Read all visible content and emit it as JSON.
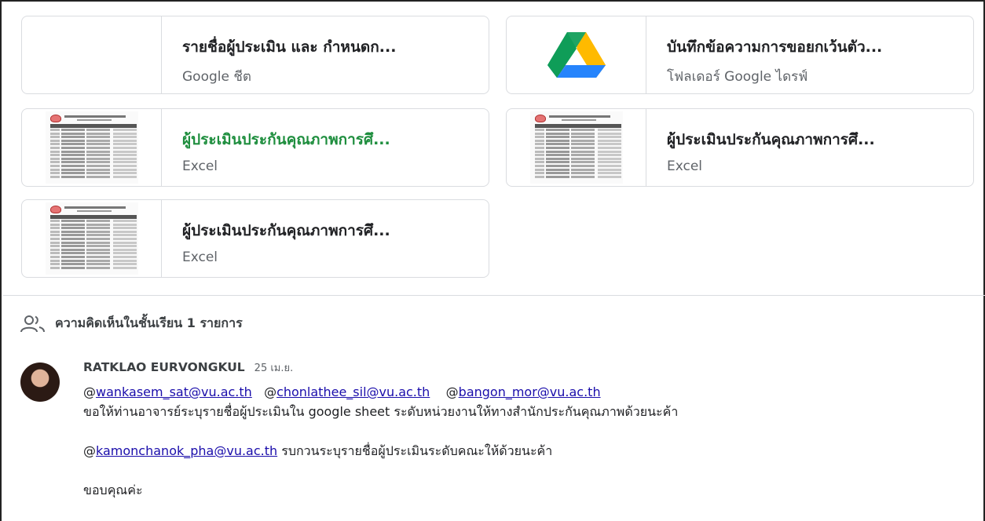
{
  "attachments": [
    {
      "title": "รายชื่อผู้ประเมิน และ กำหนดก...",
      "subtitle": "Google ชีต",
      "thumb": "blank",
      "title_color": "#202124"
    },
    {
      "title": "บันทึกข้อความการขอยกเว้นตัว...",
      "subtitle": "โฟลเดอร์ Google ไดรฟ์",
      "thumb": "google-drive-icon",
      "title_color": "#202124"
    },
    {
      "title": "ผู้ประเมินประกันคุณภาพการศึ...",
      "subtitle": "Excel",
      "thumb": "spreadsheet-preview",
      "title_color": "#1e8e3e"
    },
    {
      "title": "ผู้ประเมินประกันคุณภาพการศึ...",
      "subtitle": "Excel",
      "thumb": "spreadsheet-preview",
      "title_color": "#202124"
    },
    {
      "title": "ผู้ประเมินประกันคุณภาพการศึ...",
      "subtitle": "Excel",
      "thumb": "spreadsheet-preview",
      "title_color": "#202124"
    }
  ],
  "comments": {
    "header_label": "ความคิดเห็นในชั้นเรียน 1 รายการ",
    "header_icon": "people-icon",
    "items": [
      {
        "author": "RATKLAO EURVONGKUL",
        "date": "25 เม.ย.",
        "mention1_prefix": "@",
        "mention1": "wankasem_sat@vu.ac.th",
        "mention2_prefix": "@",
        "mention2": "chonlathee_sil@vu.ac.th",
        "mention3_prefix": "@",
        "mention3": "bangon_mor@vu.ac.th",
        "line2": "ขอให้ท่านอาจารย์ระบุรายชื่อผู้ประเมินใน google sheet ระดับหน่วยงานให้ทางสำนักประกันคุณภาพด้วยนะค้า",
        "mention4_prefix": "@",
        "mention4": "kamonchanok_pha@vu.ac.th",
        "line4_rest": " รบกวนระบุรายชื่อผู้ประเมินระดับคณะให้ด้วยนะค้า",
        "line6": "ขอบคุณค่ะ"
      }
    ]
  },
  "colors": {
    "accent_green": "#1e8e3e",
    "link": "#1a0dab",
    "border": "#dadce0"
  }
}
